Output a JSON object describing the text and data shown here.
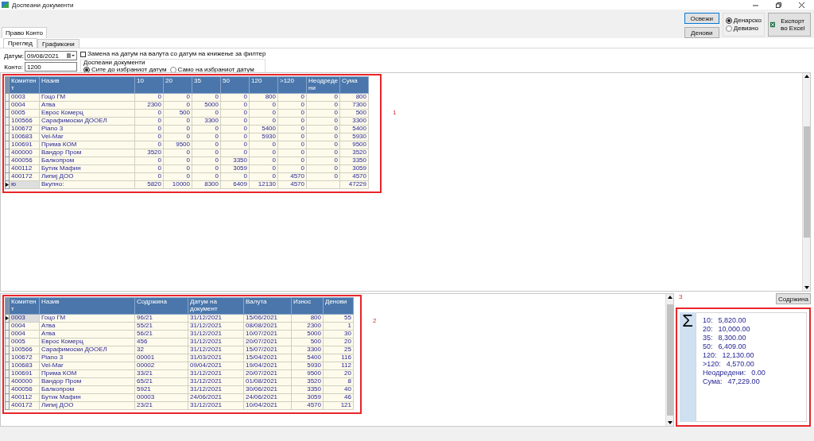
{
  "window": {
    "title": "Доспеани документи"
  },
  "toolbar": {
    "buttons": [
      {
        "label": "Освежи",
        "selected": true
      },
      {
        "label": "Денови",
        "selected": false
      }
    ],
    "currency": [
      {
        "label": "Денарско",
        "selected": true
      },
      {
        "label": "Девизно",
        "selected": false
      }
    ],
    "export": {
      "label": "Експорт во Excel"
    }
  },
  "tabs": [
    {
      "label": "Право Конто",
      "selected": true
    }
  ],
  "subtabs": [
    {
      "label": "Преглед",
      "selected": true
    },
    {
      "label": "Графикони",
      "selected": false
    }
  ],
  "filter": {
    "date_label": "Датум:",
    "date": "09/08/2021",
    "account_label": "Конто:",
    "account": "1200",
    "replace_checkbox": {
      "label": "Замена на датум на валута со датум на книжење за филтер",
      "checked": false
    },
    "group_title": "Доспеани документи",
    "options": [
      {
        "label": "Сите до избраниот датум",
        "selected": true
      },
      {
        "label": "Само на избраниот датум",
        "selected": false
      }
    ]
  },
  "aging_table": {
    "annotation": "1",
    "columns": [
      {
        "label": "Комитент",
        "kind": "text"
      },
      {
        "label": "Назив",
        "kind": "text"
      },
      {
        "label": "10",
        "kind": "number"
      },
      {
        "label": "20",
        "kind": "number"
      },
      {
        "label": "35",
        "kind": "number"
      },
      {
        "label": "50",
        "kind": "number"
      },
      {
        "label": "120",
        "kind": "number"
      },
      {
        "label": ">120",
        "kind": "number"
      },
      {
        "label": "Неодредени",
        "kind": "number"
      },
      {
        "label": "Сума",
        "kind": "number"
      }
    ],
    "rows": [
      {
        "kind": "data",
        "current": false,
        "cells": [
          "0003",
          "Гоцо ГМ",
          "0",
          "0",
          "0",
          "0",
          "800",
          "0",
          "0",
          "800"
        ]
      },
      {
        "kind": "data",
        "current": false,
        "cells": [
          "0004",
          "Атва",
          "2300",
          "0",
          "5000",
          "0",
          "0",
          "0",
          "0",
          "7300"
        ]
      },
      {
        "kind": "data",
        "current": false,
        "cells": [
          "0005",
          "Еврос Комерц",
          "0",
          "500",
          "0",
          "0",
          "0",
          "0",
          "0",
          "500"
        ]
      },
      {
        "kind": "data",
        "current": false,
        "cells": [
          "100566",
          "Сарафимоски ДООЕЛ",
          "0",
          "0",
          "3300",
          "0",
          "0",
          "0",
          "0",
          "3300"
        ]
      },
      {
        "kind": "data",
        "current": false,
        "cells": [
          "100672",
          "Piano 3",
          "0",
          "0",
          "0",
          "0",
          "5400",
          "0",
          "0",
          "5400"
        ]
      },
      {
        "kind": "data",
        "current": false,
        "cells": [
          "100683",
          "Vel-Mar",
          "0",
          "0",
          "0",
          "0",
          "5930",
          "0",
          "0",
          "5930"
        ]
      },
      {
        "kind": "data",
        "current": false,
        "cells": [
          "100691",
          "Прима КОМ",
          "0",
          "9500",
          "0",
          "0",
          "0",
          "0",
          "0",
          "9500"
        ]
      },
      {
        "kind": "data",
        "current": false,
        "cells": [
          "400000",
          "Вандор Пром",
          "3520",
          "0",
          "0",
          "0",
          "0",
          "0",
          "0",
          "3520"
        ]
      },
      {
        "kind": "data",
        "current": false,
        "cells": [
          "400056",
          "Балкопром",
          "0",
          "0",
          "0",
          "3350",
          "0",
          "0",
          "0",
          "3350"
        ]
      },
      {
        "kind": "data",
        "current": false,
        "cells": [
          "400112",
          "Бутик Мафин",
          "0",
          "0",
          "0",
          "3059",
          "0",
          "0",
          "0",
          "3059"
        ]
      },
      {
        "kind": "data",
        "current": false,
        "cells": [
          "400172",
          "Липиј ДОО",
          "0",
          "0",
          "0",
          "0",
          "0",
          "4570",
          "0",
          "4570"
        ]
      },
      {
        "kind": "total",
        "current": true,
        "cells": [
          "ю",
          "Вкупно:",
          "5820",
          "10000",
          "8300",
          "6409",
          "12130",
          "4570",
          "",
          "47229"
        ]
      }
    ]
  },
  "documents_table": {
    "annotation": "2",
    "columns": [
      {
        "label": "Комитент",
        "kind": "text"
      },
      {
        "label": "Назив",
        "kind": "text"
      },
      {
        "label": "Содржина",
        "kind": "text"
      },
      {
        "label": "Датум на документ",
        "kind": "text"
      },
      {
        "label": "Валута",
        "kind": "text"
      },
      {
        "label": "Износ",
        "kind": "number"
      },
      {
        "label": "Денови",
        "kind": "number"
      }
    ],
    "rows": [
      {
        "kind": "data",
        "current": true,
        "cells": [
          "0003",
          "Гоцо ГМ",
          "96/21",
          "31/12/2021",
          "15/06/2021",
          "800",
          "55"
        ]
      },
      {
        "kind": "data",
        "current": false,
        "cells": [
          "0004",
          "Атва",
          "55/21",
          "31/12/2021",
          "08/08/2021",
          "2300",
          "1"
        ]
      },
      {
        "kind": "data",
        "current": false,
        "cells": [
          "0004",
          "Атва",
          "56/21",
          "31/12/2021",
          "10/07/2021",
          "5000",
          "30"
        ]
      },
      {
        "kind": "data",
        "current": false,
        "cells": [
          "0005",
          "Еврос Комерц",
          "456",
          "31/12/2021",
          "20/07/2021",
          "500",
          "20"
        ]
      },
      {
        "kind": "data",
        "current": false,
        "cells": [
          "100566",
          "Сарафимоски ДООЕЛ",
          "32",
          "31/12/2021",
          "15/07/2021",
          "3300",
          "25"
        ]
      },
      {
        "kind": "data",
        "current": false,
        "cells": [
          "100672",
          "Piano 3",
          "00001",
          "31/03/2021",
          "15/04/2021",
          "5400",
          "116"
        ]
      },
      {
        "kind": "data",
        "current": false,
        "cells": [
          "100683",
          "Vel-Mar",
          "00002",
          "09/04/2021",
          "19/04/2021",
          "5930",
          "112"
        ]
      },
      {
        "kind": "data",
        "current": false,
        "cells": [
          "100691",
          "Прима КОМ",
          "33/21",
          "31/12/2021",
          "20/07/2021",
          "9500",
          "20"
        ]
      },
      {
        "kind": "data",
        "current": false,
        "cells": [
          "400000",
          "Вандор Пром",
          "65/21",
          "31/12/2021",
          "01/08/2021",
          "3520",
          "8"
        ]
      },
      {
        "kind": "data",
        "current": false,
        "cells": [
          "400056",
          "Балкопром",
          "5921",
          "31/12/2021",
          "30/06/2021",
          "3350",
          "40"
        ]
      },
      {
        "kind": "data",
        "current": false,
        "cells": [
          "400112",
          "Бутик Мафин",
          "00003",
          "24/06/2021",
          "24/06/2021",
          "3059",
          "46"
        ]
      },
      {
        "kind": "data",
        "current": false,
        "cells": [
          "400172",
          "Липиј ДОО",
          "23/21",
          "31/12/2021",
          "10/04/2021",
          "4570",
          "121"
        ]
      }
    ]
  },
  "summary": {
    "annotation": "3",
    "button": "Содржина",
    "symbol": "Σ",
    "lines": [
      {
        "label": "10:",
        "value": "5,820.00"
      },
      {
        "label": "20:",
        "value": "10,000.00"
      },
      {
        "label": "35:",
        "value": "8,300.00"
      },
      {
        "label": "50:",
        "value": "6,409.00"
      },
      {
        "label": "120:",
        "value": "12,130.00"
      },
      {
        "label": ">120:",
        "value": "4,570.00"
      },
      {
        "label": "Неодредени:",
        "value": "0.00"
      },
      {
        "label": "Сума:",
        "value": "47,229.00"
      }
    ]
  }
}
